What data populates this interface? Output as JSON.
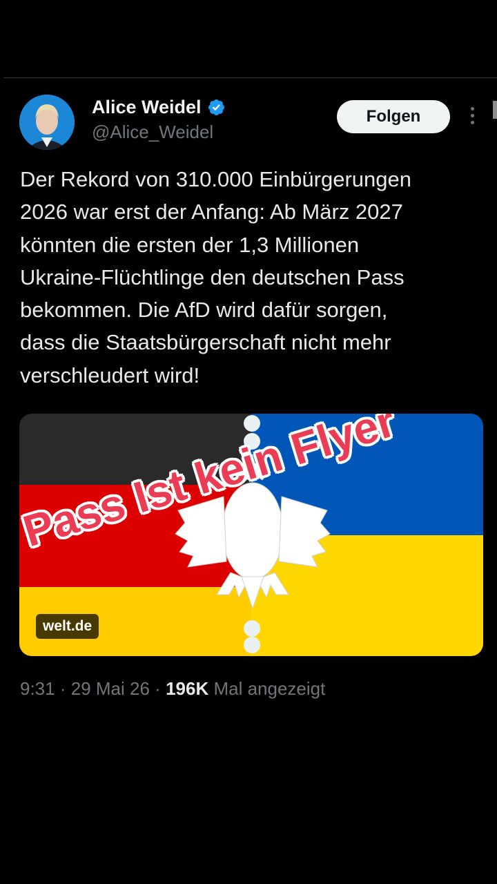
{
  "author": {
    "display_name": "Alice Weidel",
    "handle": "@Alice_Weidel"
  },
  "follow_label": "Folgen",
  "tweet_text": "Der Rekord von 310.000 Einbürgerungen\n2026 war erst der Anfang: Ab März 2027\nkönnten die ersten der 1,3 Millionen\nUkraine-Flüchtlinge den deutschen Pass\nbekommen. Die AfD wird dafür sorgen,\ndass die Staatsbürgerschaft nicht mehr\nverschleudert wird!",
  "media": {
    "overlay_text": "Pass Ist kein Flyer",
    "source": "welt.de"
  },
  "meta": {
    "time": "9:31",
    "separator": "·",
    "date": "29 Mai 26",
    "views_count": "196K",
    "views_label": "Mal angezeigt"
  },
  "colors": {
    "accent_verified": "#1d9bf0",
    "german_black": "#2a2a2a",
    "german_red": "#dd0000",
    "german_gold": "#ffcc00",
    "ukraine_blue": "#0057b7",
    "ukraine_yellow": "#ffd700",
    "overlay_red": "#ea3c54"
  },
  "icons": [
    "verified-badge-icon",
    "more-options-icon",
    "federal-eagle-icon"
  ]
}
